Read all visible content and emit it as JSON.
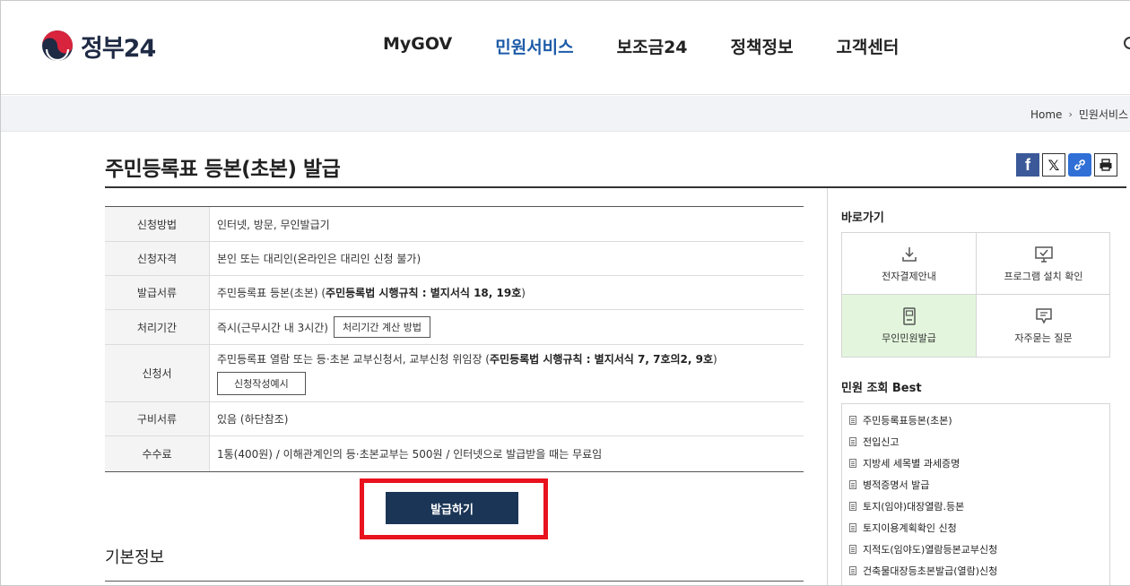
{
  "header": {
    "logo_text": "정부24",
    "nav": [
      "MyGOV",
      "민원서비스",
      "보조금24",
      "정책정보",
      "고객센터"
    ],
    "active_nav": "민원서비스"
  },
  "breadcrumb": {
    "home": "Home",
    "current": "민원서비스"
  },
  "page_title": "주민등록표 등본(초본) 발급",
  "share_icons": [
    "facebook-icon",
    "x-icon",
    "link-icon",
    "print-icon"
  ],
  "info": {
    "rows": [
      {
        "label": "신청방법",
        "value": "인터넷, 방문, 무인발급기"
      },
      {
        "label": "신청자격",
        "value": "본인 또는 대리인(온라인은 대리인 신청 불가)"
      },
      {
        "label": "발급서류",
        "value_plain": "주민등록표 등본(초본) (",
        "value_bold": "주민등록법 시행규칙 : 별지서식 18, 19호",
        "value_end": ")"
      },
      {
        "label": "처리기간",
        "value": "즉시(근무시간 내 3시간)",
        "button": "처리기간 계산 방법"
      },
      {
        "label": "신청서",
        "value_plain": "주민등록표 열람 또는 등·초본 교부신청서, 교부신청 위임장 (",
        "value_bold": "주민등록법 시행규칙 : 별지서식 7, 7호의2, 9호",
        "value_end": ")",
        "button": "신청작성예시"
      },
      {
        "label": "구비서류",
        "value": "있음 (하단참조)"
      },
      {
        "label": "수수료",
        "value": "1통(400원) / 이해관계인의 등·초본교부는 500원 / 인터넷으로 발급받을 때는 무료임"
      }
    ]
  },
  "issue_button": "발급하기",
  "section_title": "기본정보",
  "sidebar": {
    "quick_title": "바로가기",
    "quick_links": [
      {
        "label": "전자결제안내",
        "icon": "download-icon"
      },
      {
        "label": "프로그램 설치 확인",
        "icon": "monitor-icon"
      },
      {
        "label": "무인민원발급",
        "icon": "kiosk-icon"
      },
      {
        "label": "자주묻는 질문",
        "icon": "chat-icon"
      }
    ],
    "best_title": "민원 조회 Best",
    "best_items": [
      "주민등록표등본(초본)",
      "전입신고",
      "지방세 세목별 과세증명",
      "병적증명서 발급",
      "토지(임야)대장열람.등본",
      "토지이용계획확인 신청",
      "지적도(임야도)열람등본교부신청",
      "건축물대장등초본발급(열람)신청"
    ]
  },
  "colors": {
    "accent": "#1d5ba8",
    "button": "#1b3556",
    "highlight": "#e8131e",
    "kiosk_bg": "#e3f6dd"
  }
}
